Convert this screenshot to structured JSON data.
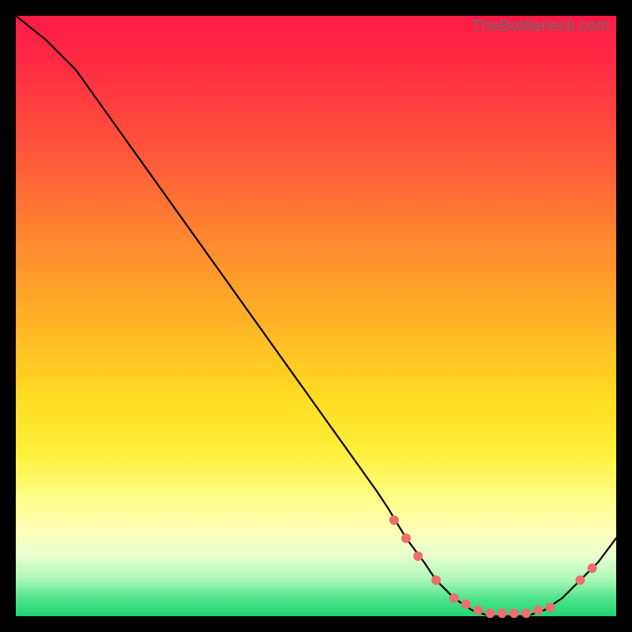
{
  "watermark": "TheBottleneck.com",
  "colors": {
    "background": "#000000",
    "curve_stroke": "#000000",
    "marker_fill": "#ee6d6d",
    "marker_stroke": "#c94f4f"
  },
  "chart_data": {
    "type": "line",
    "title": "",
    "xlabel": "",
    "ylabel": "",
    "xlim": [
      0,
      100
    ],
    "ylim": [
      0,
      100
    ],
    "grid": false,
    "legend": false,
    "series": [
      {
        "name": "bottleneck-curve",
        "x": [
          0,
          5,
          10,
          15,
          20,
          25,
          30,
          35,
          40,
          45,
          50,
          55,
          60,
          62,
          65,
          68,
          70,
          73,
          76,
          79,
          82,
          85,
          88,
          91,
          94,
          97,
          100
        ],
        "y": [
          100,
          96,
          91,
          84,
          77,
          70,
          63,
          56,
          49,
          42,
          35,
          28,
          21,
          18,
          13,
          9,
          6,
          3,
          1,
          0,
          0,
          0,
          1,
          3,
          6,
          9,
          13
        ]
      }
    ],
    "markers": {
      "name": "highlight-points",
      "x": [
        63,
        65,
        67,
        70,
        73,
        75,
        77,
        79,
        81,
        83,
        85,
        87,
        89,
        94,
        96
      ],
      "y": [
        16,
        13,
        10,
        6,
        3,
        2,
        1,
        0.5,
        0.5,
        0.5,
        0.5,
        1,
        1.5,
        6,
        8
      ]
    }
  }
}
